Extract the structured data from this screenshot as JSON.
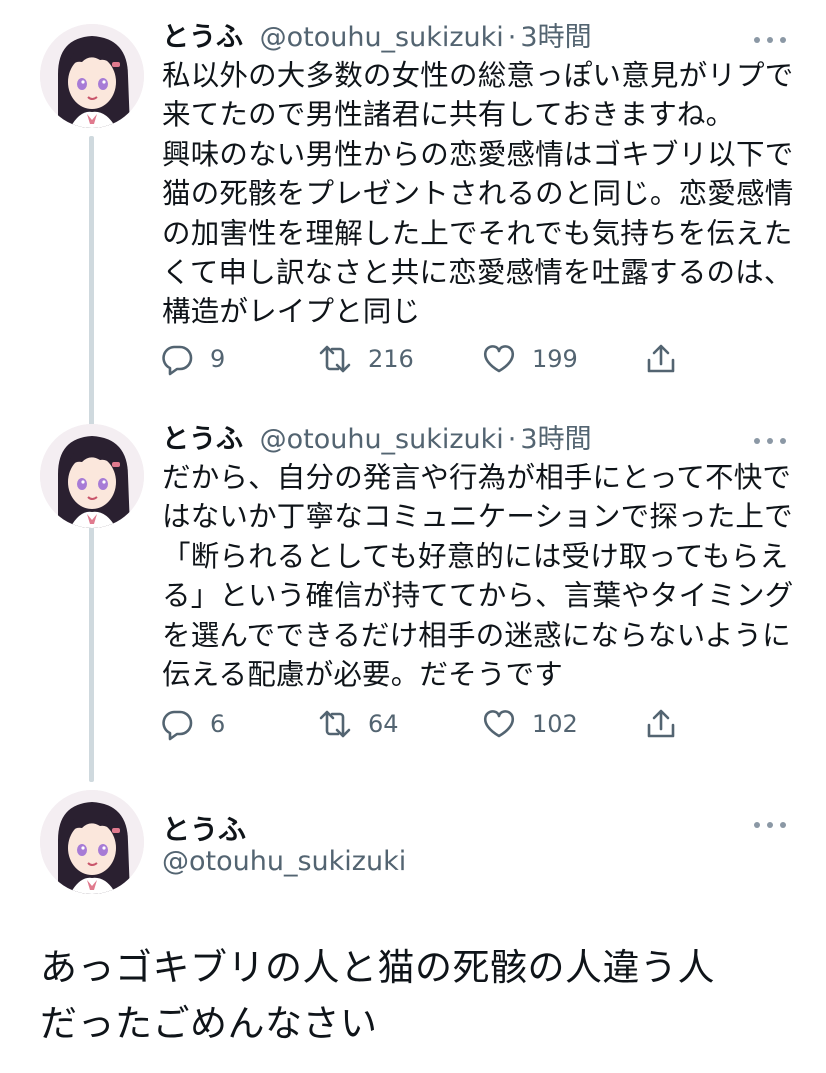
{
  "tweets": [
    {
      "name": "とうふ",
      "handle": "@otouhu_sukizuki",
      "dot": "·",
      "time": "3時間",
      "lines": [
        "私以外の大多数の女性の総意っぽい意見がリプで",
        "来てたので男性諸君に共有しておきますね。",
        "興味のない男性からの恋愛感情はゴキブリ以下で",
        "猫の死骸をプレゼントされるのと同じ。恋愛感情",
        "の加害性を理解した上でそれでも気持ちを伝えた",
        "くて申し訳なさと共に恋愛感情を吐露するのは、",
        "構造がレイプと同じ"
      ],
      "replies": "9",
      "retweets": "216",
      "likes": "199"
    },
    {
      "name": "とうふ",
      "handle": "@otouhu_sukizuki",
      "dot": "·",
      "time": "3時間",
      "lines": [
        "だから、自分の発言や行為が相手にとって不快で",
        "はないか丁寧なコミュニケーションで探った上で",
        "「断られるとしても好意的には受け取ってもらえ",
        "る」という確信が持ててから、言葉やタイミング",
        "を選んでできるだけ相手の迷惑にならないように",
        "伝える配慮が必要。だそうです"
      ],
      "replies": "6",
      "retweets": "64",
      "likes": "102"
    }
  ],
  "main_tweet": {
    "name": "とうふ",
    "handle": "@otouhu_sukizuki",
    "lines": [
      "あっゴキブリの人と猫の死骸の人違う人",
      "だったごめんなさい"
    ]
  },
  "icons": {
    "reply": "reply-icon",
    "retweet": "retweet-icon",
    "like": "heart-icon",
    "share": "share-icon",
    "more": "more-options-icon",
    "avatar": "avatar"
  },
  "colors": {
    "text": "#0f1419",
    "secondary": "#536471",
    "thread_line": "#cfd9de",
    "avatar_hair": "#2a2030",
    "avatar_eyes": "#a77bd6",
    "ribbon": "#e07a8e"
  }
}
